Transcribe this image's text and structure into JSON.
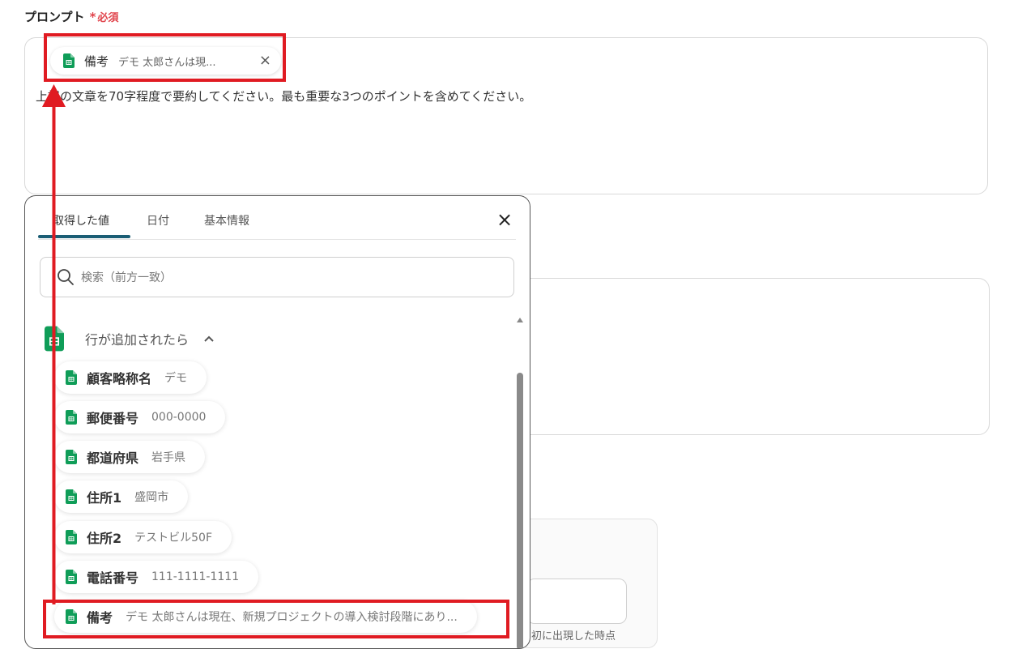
{
  "field": {
    "label": "プロンプト",
    "required_mark": "*",
    "required_text": "必須"
  },
  "prompt": {
    "chip": {
      "name": "備考",
      "value": "デモ 太郎さんは現...",
      "close_icon": "×"
    },
    "text": "上記の文章を70字程度で要約してください。最も重要な3つのポイントを含めてください。"
  },
  "background": {
    "partial_text": "初に出現した時点"
  },
  "panel": {
    "tabs": [
      {
        "label": "取得した値"
      },
      {
        "label": "日付"
      },
      {
        "label": "基本情報"
      }
    ],
    "close_icon": "×",
    "search_placeholder": "検索（前方一致）",
    "group": {
      "title": "行が追加されたら",
      "chevron": "^"
    },
    "items": [
      {
        "name": "顧客略称名",
        "value": "デモ"
      },
      {
        "name": "郵便番号",
        "value": "000-0000"
      },
      {
        "name": "都道府県",
        "value": "岩手県"
      },
      {
        "name": "住所1",
        "value": "盛岡市"
      },
      {
        "name": "住所2",
        "value": "テストビル50F"
      },
      {
        "name": "電話番号",
        "value": "111-1111-1111"
      },
      {
        "name": "備考",
        "value": "デモ 太郎さんは現在、新規プロジェクトの導入検討段階にあり..."
      }
    ]
  },
  "colors": {
    "accent": "#1b5e75",
    "required": "#e0434b",
    "annotation": "#e01b22",
    "sheets_green": "#0f9d58"
  },
  "icons": {
    "sheet": "google-sheets-icon",
    "search": "search-icon",
    "close": "close-icon",
    "chevron": "chevron-up-icon"
  }
}
